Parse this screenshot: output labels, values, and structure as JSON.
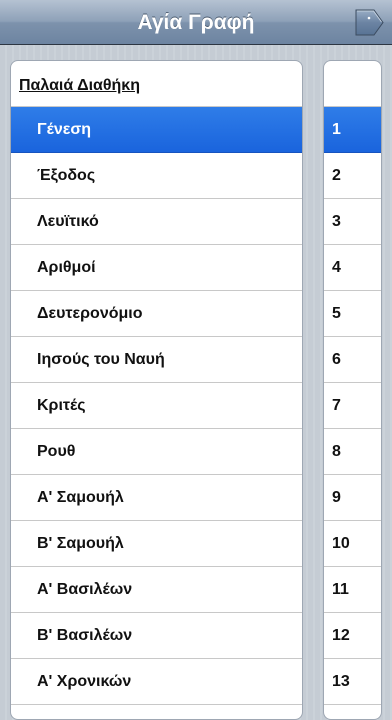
{
  "app": {
    "title": "Αγία Γραφή"
  },
  "nav": {
    "right_button_icon": "page-fold-icon"
  },
  "section": {
    "title": "Παλαιά Διαθήκη"
  },
  "books": [
    {
      "name": "Γένεση",
      "number": "1",
      "selected": true
    },
    {
      "name": "Έξοδος",
      "number": "2",
      "selected": false
    },
    {
      "name": "Λευϊτικό",
      "number": "3",
      "selected": false
    },
    {
      "name": "Αριθμοί",
      "number": "4",
      "selected": false
    },
    {
      "name": "Δευτερονόμιο",
      "number": "5",
      "selected": false
    },
    {
      "name": "Ιησούς του Ναυή",
      "number": "6",
      "selected": false
    },
    {
      "name": "Κριτές",
      "number": "7",
      "selected": false
    },
    {
      "name": "Ρουθ",
      "number": "8",
      "selected": false
    },
    {
      "name": "Α' Σαμουήλ",
      "number": "9",
      "selected": false
    },
    {
      "name": "Β' Σαμουήλ",
      "number": "10",
      "selected": false
    },
    {
      "name": "Α' Βασιλέων",
      "number": "11",
      "selected": false
    },
    {
      "name": "Β' Βασιλέων",
      "number": "12",
      "selected": false
    },
    {
      "name": "Α' Χρονικών",
      "number": "13",
      "selected": false
    }
  ],
  "colors": {
    "selection": "#1a64dd",
    "navbar": "#8ea1b8",
    "background": "#c5ccd4"
  }
}
